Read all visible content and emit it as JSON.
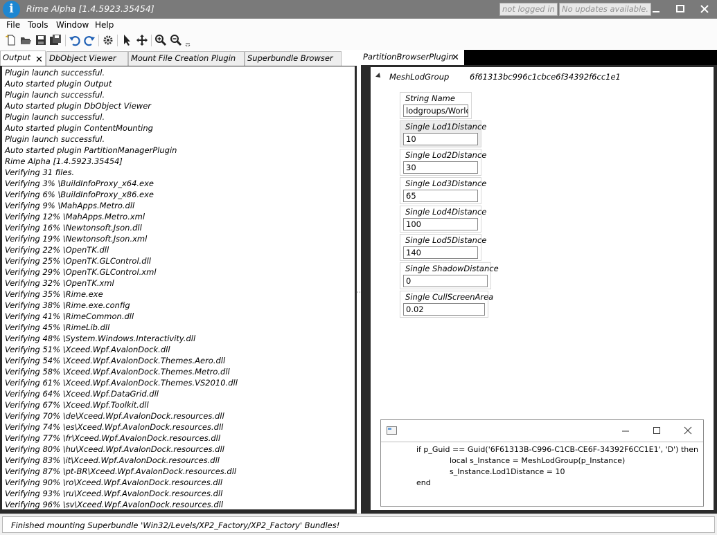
{
  "window": {
    "title": "Rime Alpha [1.4.5923.35454]",
    "login_status": "not logged in",
    "update_status": "No updates available.",
    "colors": {
      "titlebar": "#7a7a7a",
      "app_icon": "#1d86d1"
    }
  },
  "menu": {
    "items": [
      "File",
      "Tools",
      "Window",
      "Help"
    ]
  },
  "toolbar": {
    "icons": [
      "new-icon",
      "open-icon",
      "save-icon",
      "save-all-icon",
      "undo-icon",
      "redo-icon",
      "settings-icon",
      "pointer-icon",
      "move-icon",
      "zoom-in-icon",
      "zoom-out-icon",
      "overflow-icon"
    ]
  },
  "left_dock": {
    "tabs": [
      "Output",
      "DbObject Viewer",
      "Mount File Creation Plugin",
      "Superbundle Browser"
    ],
    "output_lines": [
      "Plugin launch successful.",
      "Auto started plugin Output",
      "Plugin launch successful.",
      "Auto started plugin DbObject Viewer",
      "Plugin launch successful.",
      "Auto started plugin ContentMounting",
      "Plugin launch successful.",
      "Auto started plugin PartitionManagerPlugin",
      "Rime Alpha [1.4.5923.35454]",
      "Verifying 31 files.",
      "Verifying 3% \\BuildInfoProxy_x64.exe",
      "Verifying 6% \\BuildInfoProxy_x86.exe",
      "Verifying 9% \\MahApps.Metro.dll",
      "Verifying 12% \\MahApps.Metro.xml",
      "Verifying 16% \\Newtonsoft.Json.dll",
      "Verifying 19% \\Newtonsoft.Json.xml",
      "Verifying 22% \\OpenTK.dll",
      "Verifying 25% \\OpenTK.GLControl.dll",
      "Verifying 29% \\OpenTK.GLControl.xml",
      "Verifying 32% \\OpenTK.xml",
      "Verifying 35% \\Rime.exe",
      "Verifying 38% \\Rime.exe.config",
      "Verifying 41% \\RimeCommon.dll",
      "Verifying 45% \\RimeLib.dll",
      "Verifying 48% \\System.Windows.Interactivity.dll",
      "Verifying 51% \\Xceed.Wpf.AvalonDock.dll",
      "Verifying 54% \\Xceed.Wpf.AvalonDock.Themes.Aero.dll",
      "Verifying 58% \\Xceed.Wpf.AvalonDock.Themes.Metro.dll",
      "Verifying 61% \\Xceed.Wpf.AvalonDock.Themes.VS2010.dll",
      "Verifying 64% \\Xceed.Wpf.DataGrid.dll",
      "Verifying 67% \\Xceed.Wpf.Toolkit.dll",
      "Verifying 70% \\de\\Xceed.Wpf.AvalonDock.resources.dll",
      "Verifying 74% \\es\\Xceed.Wpf.AvalonDock.resources.dll",
      "Verifying 77% \\fr\\Xceed.Wpf.AvalonDock.resources.dll",
      "Verifying 80% \\hu\\Xceed.Wpf.AvalonDock.resources.dll",
      "Verifying 83% \\it\\Xceed.Wpf.AvalonDock.resources.dll",
      "Verifying 87% \\pt-BR\\Xceed.Wpf.AvalonDock.resources.dll",
      "Verifying 90% \\ro\\Xceed.Wpf.AvalonDock.resources.dll",
      "Verifying 93% \\ru\\Xceed.Wpf.AvalonDock.resources.dll",
      "Verifying 96% \\sv\\Xceed.Wpf.AvalonDock.resources.dll"
    ]
  },
  "right_dock": {
    "tab": "PartitionBrowserPlugin",
    "tree": {
      "name": "MeshLodGroup",
      "guid": "6f61313bc996c1cbce6f34392f6cc1e1"
    },
    "properties": [
      {
        "label": "String Name",
        "value": "lodgroups/World"
      },
      {
        "label": "Single Lod1Distance",
        "value": "10"
      },
      {
        "label": "Single Lod2Distance",
        "value": "30"
      },
      {
        "label": "Single Lod3Distance",
        "value": "65"
      },
      {
        "label": "Single Lod4Distance",
        "value": "100"
      },
      {
        "label": "Single Lod5Distance",
        "value": "140"
      },
      {
        "label": "Single ShadowDistance",
        "value": "0"
      },
      {
        "label": "Single CullScreenArea",
        "value": "0.02"
      }
    ]
  },
  "script_window": {
    "code": [
      "if p_Guid == Guid('6F61313B-C996-C1CB-CE6F-34392F6CC1E1', 'D') then",
      "local s_Instance = MeshLodGroup(p_Instance)",
      "s_Instance.Lod1Distance = 10",
      "end"
    ]
  },
  "status": {
    "text": "Finished mounting Superbundle 'Win32/Levels/XP2_Factory/XP2_Factory' Bundles!"
  }
}
